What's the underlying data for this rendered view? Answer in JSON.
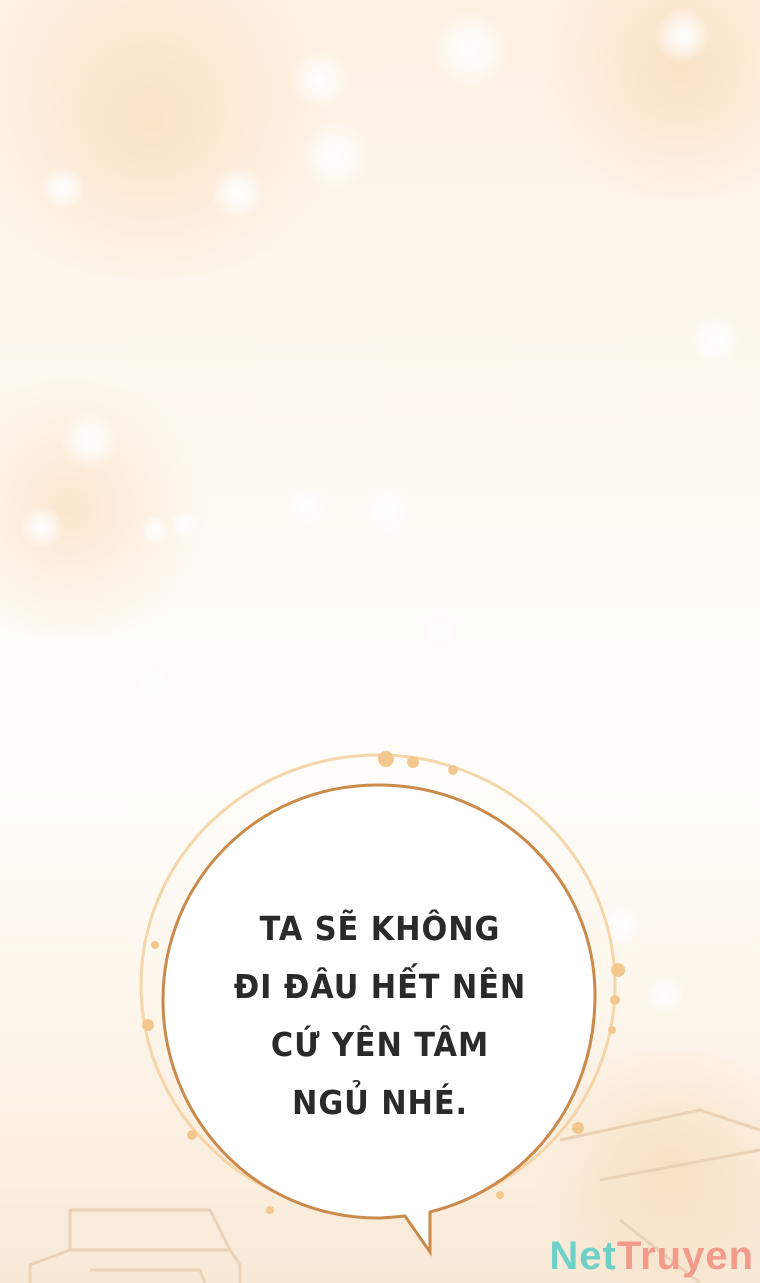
{
  "speech_bubble": {
    "lines": [
      "TA SẼ KHÔNG",
      "ĐI ĐÂU HẾT NÊN",
      "CỨ YÊN TÂM",
      "NGỦ NHÉ."
    ]
  },
  "watermark": {
    "part1": "Net",
    "part2": "Truyen"
  },
  "colors": {
    "bubble_outline": "#c98a4b",
    "bubble_halo": "#f3cf9e",
    "text": "#2a2a2a",
    "watermark_net": "#6fd0c8",
    "watermark_truyen": "#f29a8c"
  }
}
